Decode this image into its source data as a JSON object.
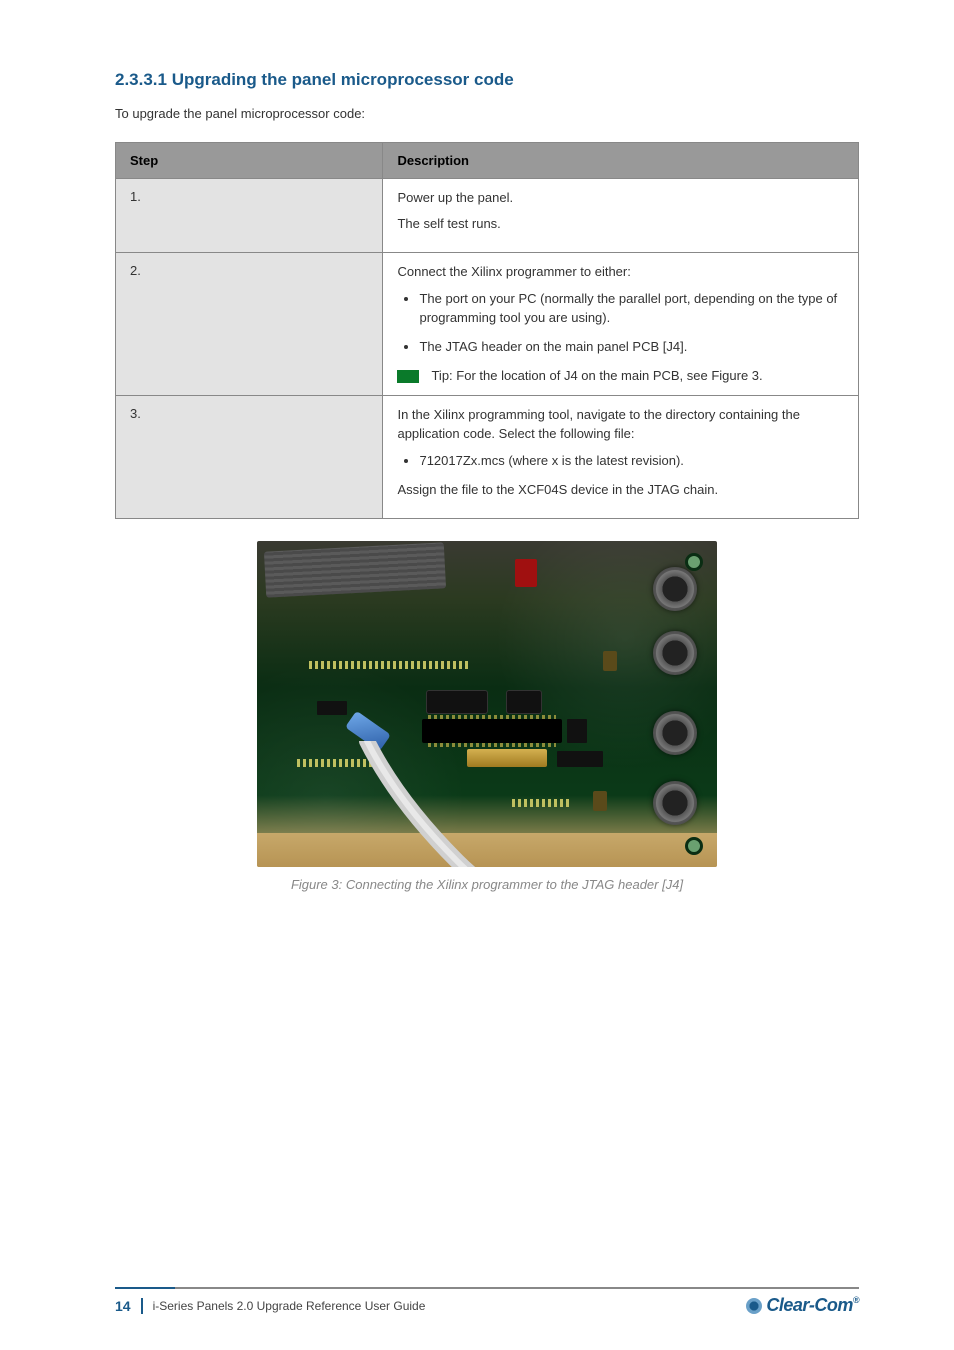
{
  "section": "2.3.3.1 Upgrading the panel microprocessor code",
  "intro": "To upgrade the panel microprocessor code:",
  "thead": {
    "col1": "Step",
    "col2": "Description"
  },
  "rows": [
    {
      "step": "1.",
      "lines": [
        "Power up the panel.",
        "The self test runs."
      ]
    },
    {
      "step": "2.",
      "lines": [
        "Connect the Xilinx programmer to either:"
      ],
      "bullets": [
        "The port on your PC (normally the parallel port, depending on the type of programming tool you are using).",
        "The JTAG header on the main panel PCB [J4]."
      ],
      "tip": "Tip: For the location of J4 on the main PCB, see Figure 3."
    },
    {
      "step": "3.",
      "lines": [
        "In the Xilinx programming tool, navigate to the directory containing the application code. Select the following file:"
      ],
      "bullets": [
        "712017Zx.mcs (where x is the latest revision)."
      ],
      "lines2": [
        "Assign the file to the XCF04S device in the JTAG chain."
      ]
    }
  ],
  "figure_caption": "Figure 3: Connecting the Xilinx programmer to the JTAG header [J4]",
  "footer": {
    "page": "14",
    "text": "i-Series Panels 2.0 Upgrade Reference User Guide",
    "brand": "Clear-Com",
    "reg": "®"
  }
}
